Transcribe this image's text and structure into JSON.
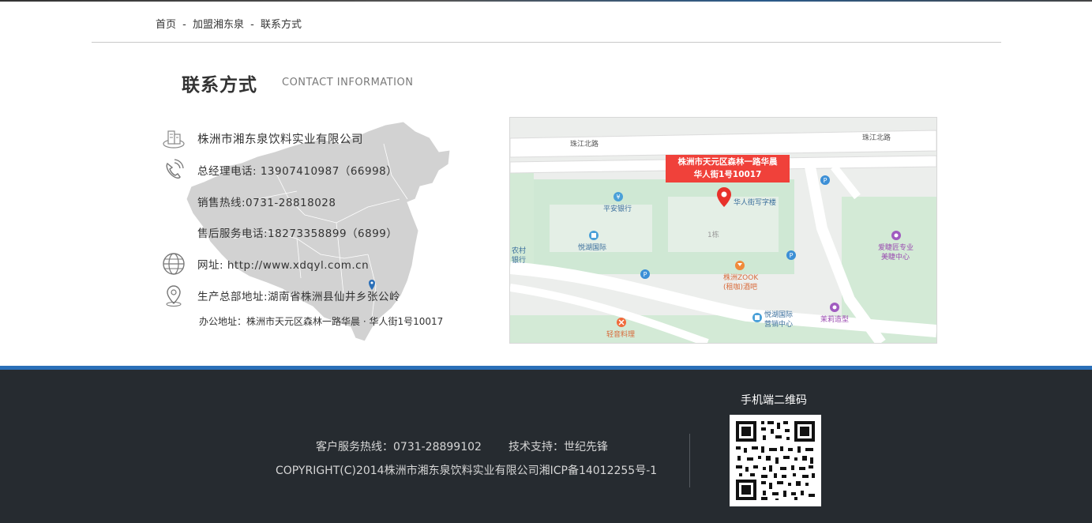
{
  "breadcrumb": {
    "home": "首页",
    "level1": "加盟湘东泉",
    "level2": "联系方式",
    "separator": "-"
  },
  "section": {
    "title_cn": "联系方式",
    "title_en": "CONTACT INFORMATION"
  },
  "contact": {
    "company": "株洲市湘东泉饮料实业有限公司",
    "manager_phone": "总经理电话: 13907410987（66998）",
    "sales_hotline": "销售热线:0731-28818028",
    "after_sales": "售后服务电话:18273358899（6899）",
    "website": "网址: http://www.xdqyl.com.cn",
    "hq_address": "生产总部地址:湖南省株洲县仙井乡张公岭",
    "office_address": "办公地址：株洲市天元区森林一路华晨 · 华人街1号10017"
  },
  "map": {
    "popup_line1": "株洲市天元区森林一路华晨",
    "popup_line2": "华人街1号10017",
    "road1": "珠江北路",
    "road2": "珠江北路",
    "poi_pingan": "平安银行",
    "poi_huaren": "华人街写字楼",
    "poi_yuehu": "悦湖国际",
    "poi_nongcun1": "农村",
    "poi_nongcun2": "银行",
    "poi_building": "1栋",
    "poi_zook1": "株洲ZOOK",
    "poi_zook2": "(租咖)酒吧",
    "poi_aijie1": "爱睫匠专业",
    "poi_aijie2": "美睫中心",
    "poi_yuehu_sales1": "悦湖国际",
    "poi_yuehu_sales2": "营销中心",
    "poi_moli": "茉莉造型",
    "poi_qingyin": "轻音料理"
  },
  "footer": {
    "hotline": "客户服务热线：0731-28899102",
    "tech": "技术支持：世纪先锋",
    "copyright": "COPYRIGHT(C)2014株洲市湘东泉饮料实业有限公司湘ICP备14012255号-1",
    "qr_title": "手机端二维码"
  },
  "colors": {
    "footer_bg": "#262b30",
    "footer_accent": "#2a6fb8",
    "map_popup": "#f0413a"
  }
}
